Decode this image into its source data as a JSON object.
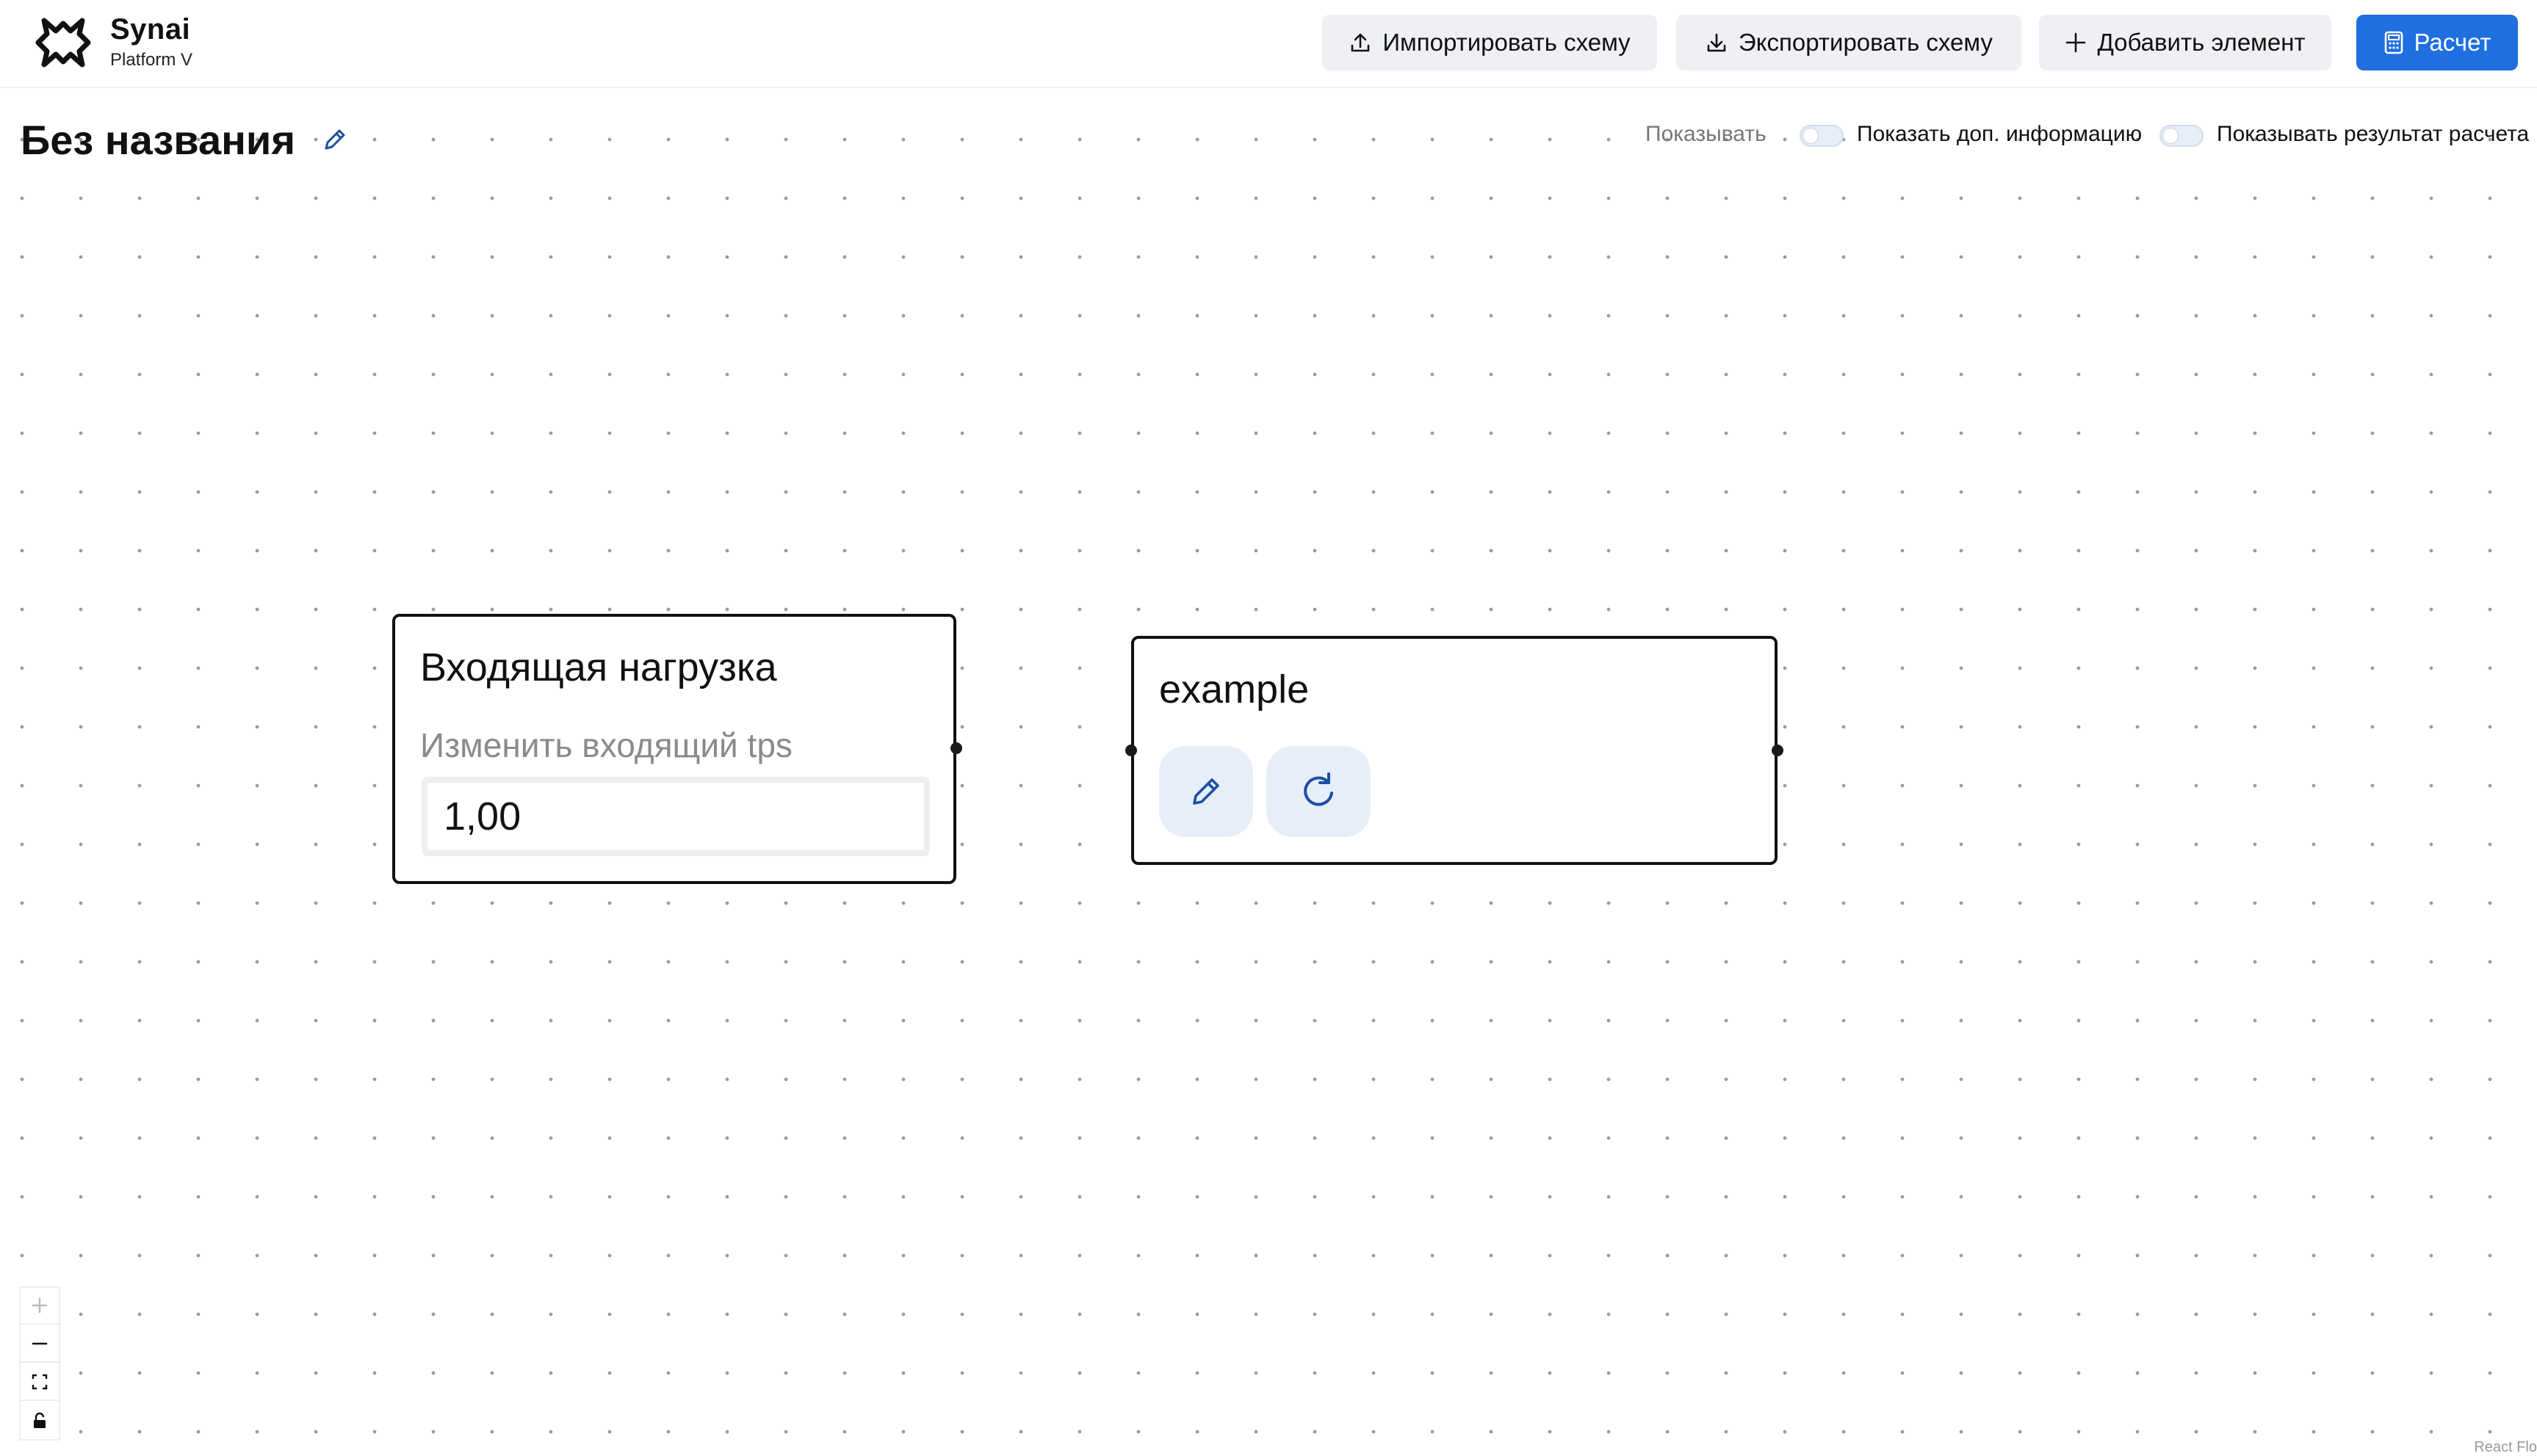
{
  "header": {
    "brand_name": "Synai",
    "brand_sub": "Platform V",
    "buttons": {
      "import": "Импортировать схему",
      "export": "Экспортировать схему",
      "add": "Добавить элемент",
      "calc": "Расчет"
    }
  },
  "page": {
    "title": "Без названия"
  },
  "toggles": {
    "show_label": "Показывать",
    "info_label": "Показать доп. информацию",
    "info_enabled": false,
    "result_label": "Показывать результат расчета",
    "result_enabled": false
  },
  "nodes": {
    "input_load": {
      "title": "Входящая нагрузка",
      "field_label": "Изменить входящий tps",
      "value": "1,00"
    },
    "example": {
      "title": "example"
    }
  },
  "icons": {
    "logo": "synai-logo-icon",
    "import": "upload-icon",
    "export": "download-icon",
    "add": "plus-icon",
    "calc": "calculator-icon",
    "title_edit": "pencil-icon",
    "node_edit": "pencil-icon",
    "node_refresh": "refresh-icon",
    "zoom_in": "plus-icon",
    "zoom_out": "minus-icon",
    "fit_view": "fit-view-icon",
    "lock": "lock-icon"
  },
  "attribution": "React Flo",
  "colors": {
    "accent": "#1f6fe0",
    "button_bg": "#eef0f3",
    "node_button_bg": "#e6eefa",
    "icon_blue": "#1d4fa3"
  }
}
